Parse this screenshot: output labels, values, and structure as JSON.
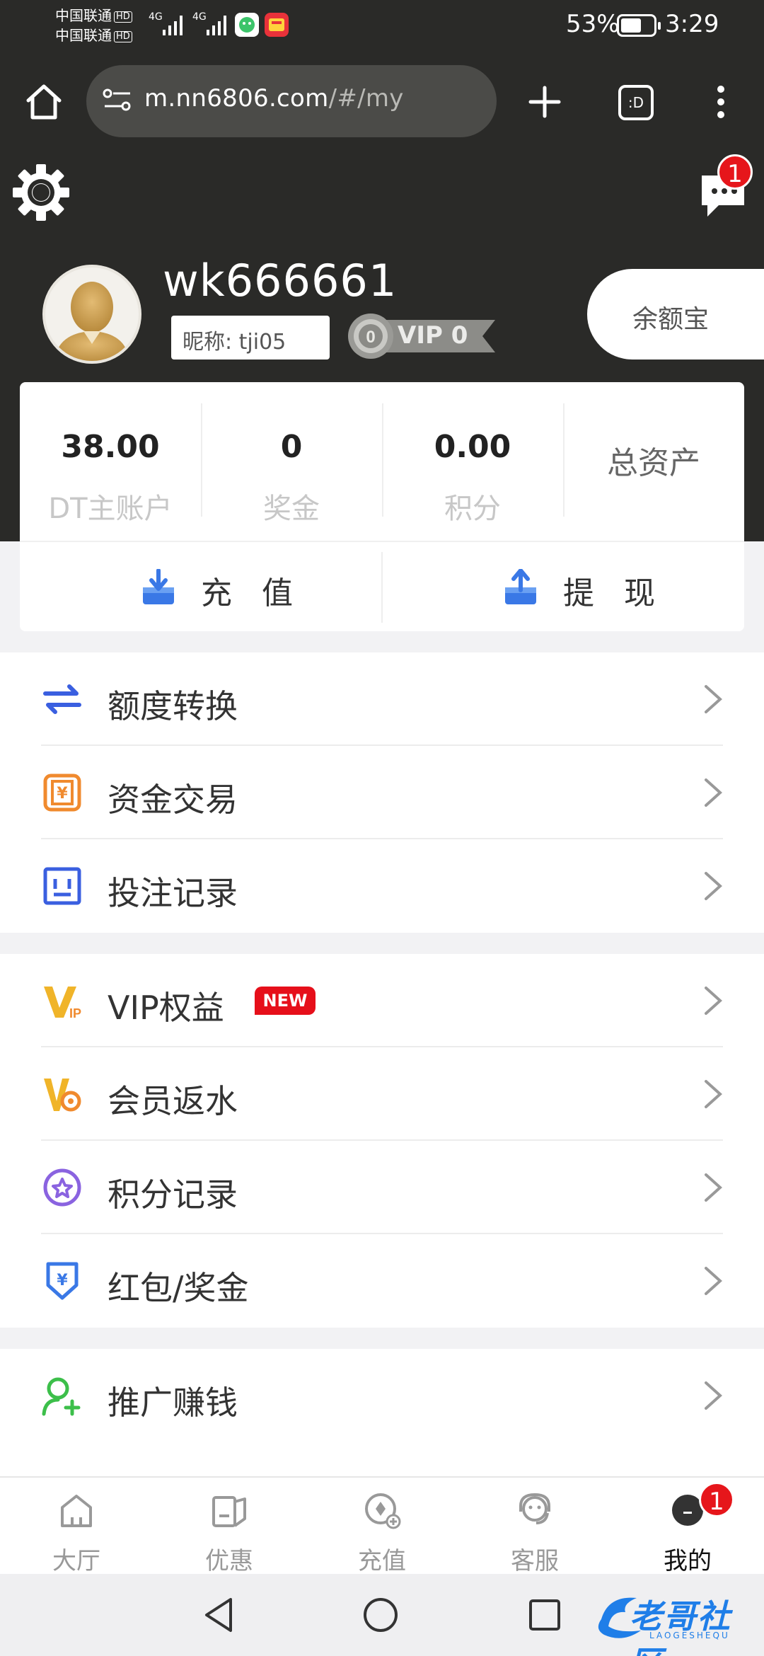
{
  "status_bar": {
    "carrier_1": "中国联通",
    "carrier_2": "中国联通",
    "hd": "HD",
    "network_1": "4G",
    "network_2": "4G",
    "battery_percent": "53%",
    "time": "3:29"
  },
  "browser": {
    "url_main": "m.nn6806.com",
    "url_path": "/#/my",
    "tab_count_label": ":D"
  },
  "header": {
    "message_badge": "1"
  },
  "profile": {
    "username": "wk666661",
    "nickname": "昵称: tji05",
    "vip_label": "VIP 0",
    "yuebao_button": "余额宝"
  },
  "stats": [
    {
      "value": "38.00",
      "label": "DT主账户"
    },
    {
      "value": "0",
      "label": "奖金"
    },
    {
      "value": "0.00",
      "label": "积分"
    }
  ],
  "total_assets_label": "总资产",
  "actions": {
    "deposit": "充 值",
    "withdraw": "提 现"
  },
  "menu_group_1": [
    {
      "label": "额度转换"
    },
    {
      "label": "资金交易"
    },
    {
      "label": "投注记录"
    }
  ],
  "menu_group_2": [
    {
      "label": "VIP权益",
      "badge": "NEW"
    },
    {
      "label": "会员返水"
    },
    {
      "label": "积分记录"
    },
    {
      "label": "红包/奖金"
    }
  ],
  "menu_group_3": [
    {
      "label": "推广赚钱"
    }
  ],
  "tabs": [
    {
      "label": "大厅"
    },
    {
      "label": "优惠"
    },
    {
      "label": "充值"
    },
    {
      "label": "客服"
    },
    {
      "label": "我的",
      "badge": "1"
    }
  ],
  "watermark": {
    "text": "老哥社区",
    "sub": "LAOGESHEQU"
  },
  "colors": {
    "header_bg": "#2a2a28",
    "badge_red": "#e6161b",
    "new_badge": "#e60f1a",
    "icon_blue": "#3a78e6",
    "icon_orange": "#f08a2e",
    "icon_gold": "#f0b429",
    "icon_purple": "#8a63e0",
    "icon_green": "#3cbf4a"
  }
}
